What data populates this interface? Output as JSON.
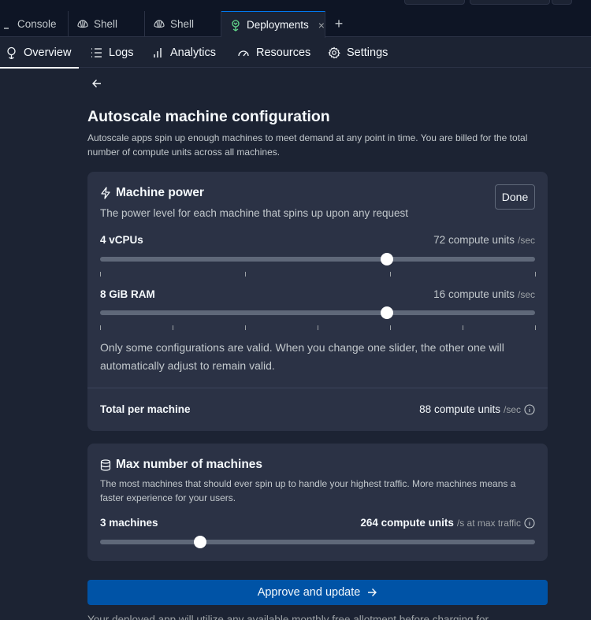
{
  "tabs": [
    {
      "label": "Console",
      "icon": "terminal-icon"
    },
    {
      "label": "Shell",
      "icon": "shell-icon"
    },
    {
      "label": "Shell",
      "icon": "shell-icon"
    },
    {
      "label": "Deployments",
      "icon": "deployments-icon",
      "active": true
    }
  ],
  "tab_close": "×",
  "tab_add": "+",
  "subnav": [
    {
      "label": "Overview",
      "icon": "overview-icon",
      "active": true
    },
    {
      "label": "Logs",
      "icon": "list-icon"
    },
    {
      "label": "Analytics",
      "icon": "bar-chart-icon"
    },
    {
      "label": "Resources",
      "icon": "gauge-icon"
    },
    {
      "label": "Settings",
      "icon": "gear-icon"
    }
  ],
  "page": {
    "title": "Autoscale machine configuration",
    "description": "Autoscale apps spin up enough machines to meet demand at any point in time. You are billed for the total number of compute units across all machines."
  },
  "machine_power": {
    "title": "Machine power",
    "subtitle": "The power level for each machine that spins up upon any request",
    "done_label": "Done",
    "cpu": {
      "label": "4 vCPUs",
      "value": "72 compute units",
      "unit": "/sec",
      "slider_fraction": 0.66
    },
    "ram": {
      "label": "8 GiB RAM",
      "value": "16 compute units",
      "unit": "/sec",
      "slider_fraction": 0.66
    },
    "note": "Only some configurations are valid. When you change one slider, the other one will automatically adjust to remain valid.",
    "total_label": "Total per machine",
    "total_value": "88 compute units",
    "total_unit": "/sec"
  },
  "max_machines": {
    "title": "Max number of machines",
    "subtitle": "The most machines that should ever spin up to handle your highest traffic. More machines means a faster experience for your users.",
    "label": "3 machines",
    "value": "264 compute units",
    "unit": "/s at max traffic",
    "slider_fraction": 0.23
  },
  "approve_label": "Approve and update",
  "footnote": "Your deployed app will utilize any available monthly free allotment before charging for"
}
